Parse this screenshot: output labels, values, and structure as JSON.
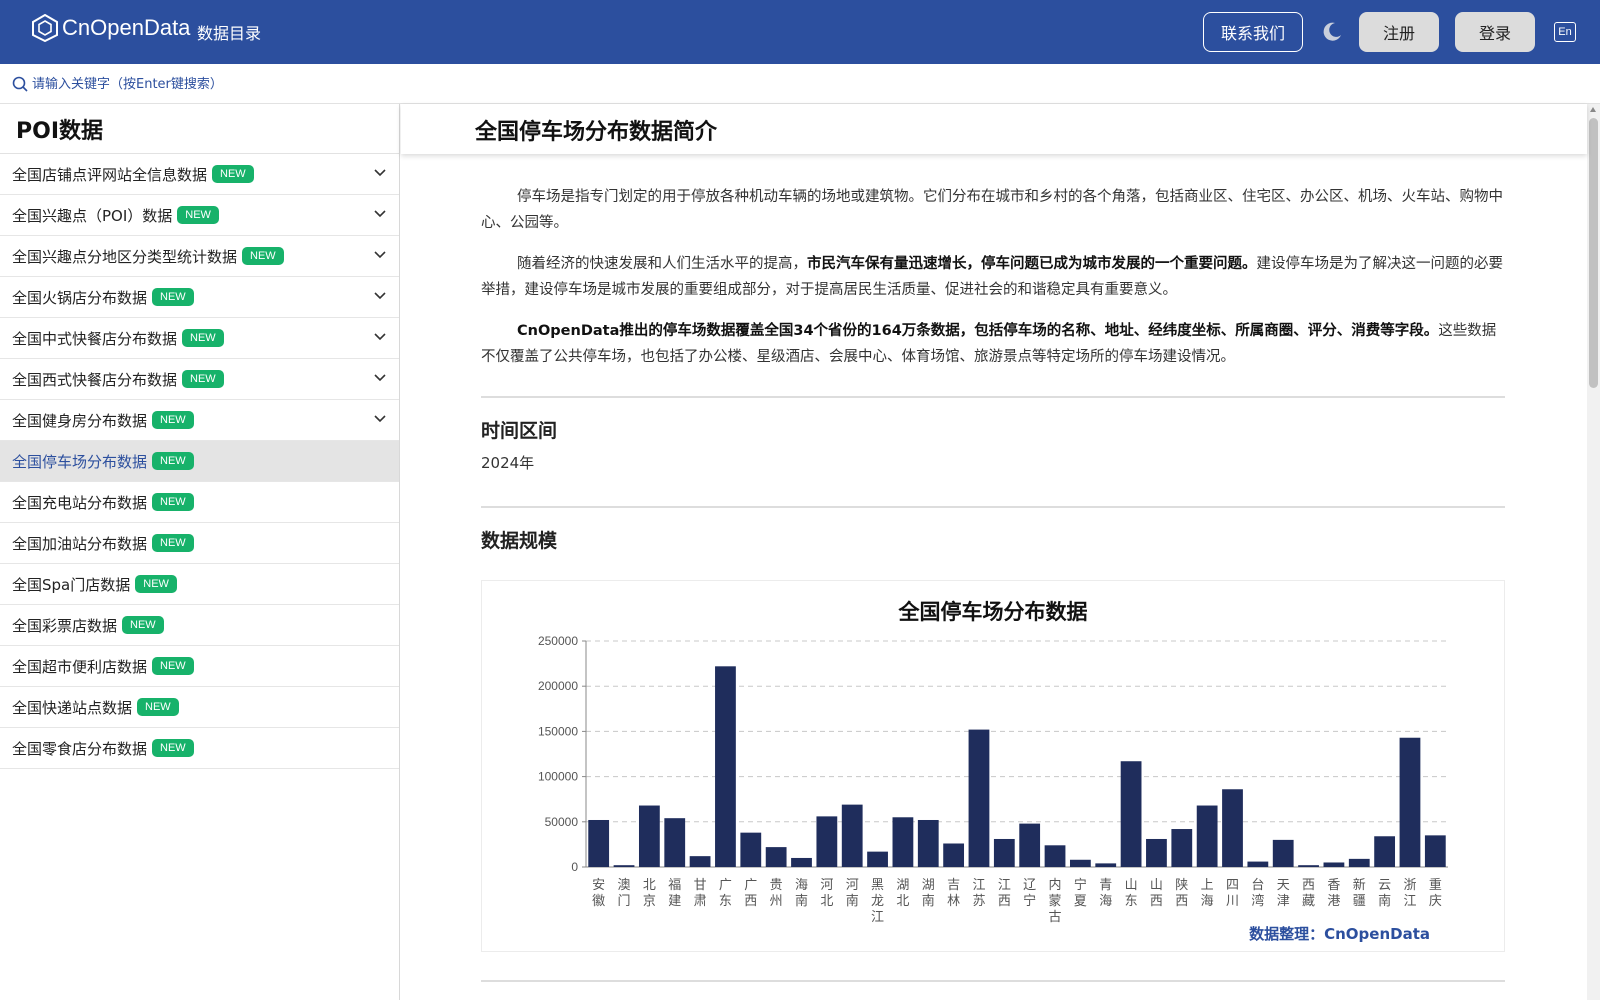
{
  "header": {
    "logo_text": "CnOpenData",
    "nav_catalog": "数据目录",
    "contact": "联系我们",
    "register": "注册",
    "login": "登录",
    "lang": "En"
  },
  "search": {
    "placeholder": "请输入关键字（按Enter键搜索）"
  },
  "sidebar": {
    "title": "POI数据",
    "badge": "NEW",
    "items": [
      {
        "label": "全国店铺点评网站全信息数据",
        "expandable": true,
        "active": false
      },
      {
        "label": "全国兴趣点（POI）数据",
        "expandable": true,
        "active": false
      },
      {
        "label": "全国兴趣点分地区分类型统计数据",
        "expandable": true,
        "active": false
      },
      {
        "label": "全国火锅店分布数据",
        "expandable": true,
        "active": false
      },
      {
        "label": "全国中式快餐店分布数据",
        "expandable": true,
        "active": false
      },
      {
        "label": "全国西式快餐店分布数据",
        "expandable": true,
        "active": false
      },
      {
        "label": "全国健身房分布数据",
        "expandable": true,
        "active": false
      },
      {
        "label": "全国停车场分布数据",
        "expandable": false,
        "active": true
      },
      {
        "label": "全国充电站分布数据",
        "expandable": false,
        "active": false
      },
      {
        "label": "全国加油站分布数据",
        "expandable": false,
        "active": false
      },
      {
        "label": "全国Spa门店数据",
        "expandable": false,
        "active": false
      },
      {
        "label": "全国彩票店数据",
        "expandable": false,
        "active": false
      },
      {
        "label": "全国超市便利店数据",
        "expandable": false,
        "active": false
      },
      {
        "label": "全国快递站点数据",
        "expandable": false,
        "active": false
      },
      {
        "label": "全国零食店分布数据",
        "expandable": false,
        "active": false
      }
    ]
  },
  "main": {
    "title": "全国停车场分布数据简介",
    "p1": "停车场是指专门划定的用于停放各种机动车辆的场地或建筑物。它们分布在城市和乡村的各个角落，包括商业区、住宅区、办公区、机场、火车站、购物中心、公园等。",
    "p2_a": "随着经济的快速发展和人们生活水平的提高，",
    "p2_b": "市民汽车保有量迅速增长，停车问题已成为城市发展的一个重要问题。",
    "p2_c": "建设停车场是为了解决这一问题的必要举措，建设停车场是城市发展的重要组成部分，对于提高居民生活质量、促进社会的和谐稳定具有重要意义。",
    "p3_a": "CnOpenData推出的停车场数据覆盖全国34个省份的164万条数据，包括停车场的名称、地址、经纬度坐标、所属商圈、评分、消费等字段。",
    "p3_b": "这些数据不仅覆盖了公共停车场，也包括了办公楼、星级酒店、会展中心、体育场馆、旅游景点等特定场所的停车场建设情况。",
    "time_heading": "时间区间",
    "time_value": "2024年",
    "scale_heading": "数据规模"
  },
  "colors": {
    "brand": "#2c4f9e",
    "badge": "#17b26a",
    "bar": "#1f2d5c"
  },
  "chart_data": {
    "type": "bar",
    "title": "全国停车场分布数据",
    "credit": "数据整理：CnOpenData",
    "ylim": [
      0,
      250000
    ],
    "yticks": [
      0,
      50000,
      100000,
      150000,
      200000,
      250000
    ],
    "grid": true,
    "categories": [
      "安徽",
      "澳门",
      "北京",
      "福建",
      "甘肃",
      "广东",
      "广西",
      "贵州",
      "海南",
      "河北",
      "河南",
      "黑龙江",
      "湖北",
      "湖南",
      "吉林",
      "江苏",
      "江西",
      "辽宁",
      "内蒙古",
      "宁夏",
      "青海",
      "山东",
      "山西",
      "陕西",
      "上海",
      "四川",
      "台湾",
      "天津",
      "西藏",
      "香港",
      "新疆",
      "云南",
      "浙江",
      "重庆"
    ],
    "values": [
      52000,
      2000,
      68000,
      54000,
      12000,
      222000,
      38000,
      22000,
      10000,
      56000,
      69000,
      17000,
      55000,
      52000,
      26000,
      152000,
      31000,
      48000,
      24000,
      8000,
      4000,
      117000,
      31000,
      42000,
      68000,
      86000,
      6000,
      30000,
      2000,
      5000,
      9000,
      34000,
      143000,
      35000
    ]
  }
}
